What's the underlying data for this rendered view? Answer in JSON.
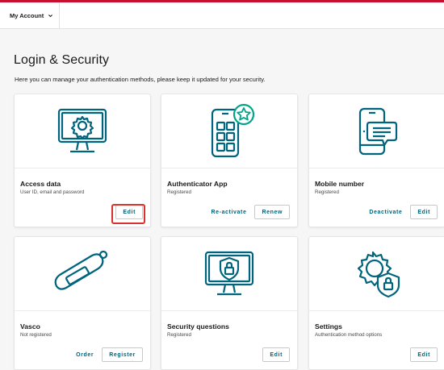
{
  "header": {
    "account_label": "My Account",
    "accent_color": "#c8102e"
  },
  "page": {
    "title": "Login & Security",
    "subtitle": "Here you can manage your authentication methods, please keep it updated for your security."
  },
  "theme": {
    "icon_color": "#00647d",
    "icon_accent": "#00a58a",
    "highlight_color": "#d9332b"
  },
  "cards": [
    {
      "title": "Access data",
      "status": "User ID, email and password",
      "icon": "monitor-gear-icon",
      "primary": "Edit"
    },
    {
      "title": "Authenticator App",
      "status": "Registered",
      "icon": "phone-qr-star-icon",
      "secondary": "Re-activate",
      "primary": "Renew"
    },
    {
      "title": "Mobile number",
      "status": "Registered",
      "icon": "phone-chat-icon",
      "secondary": "Deactivate",
      "primary": "Edit"
    },
    {
      "title": "Vasco",
      "status": "Not registered",
      "icon": "token-device-icon",
      "secondary": "Order",
      "primary": "Register"
    },
    {
      "title": "Security questions",
      "status": "Registered",
      "icon": "monitor-shield-lock-icon",
      "primary": "Edit"
    },
    {
      "title": "Settings",
      "status": "Authentication method options",
      "icon": "gear-shield-lock-icon",
      "primary": "Edit"
    }
  ]
}
